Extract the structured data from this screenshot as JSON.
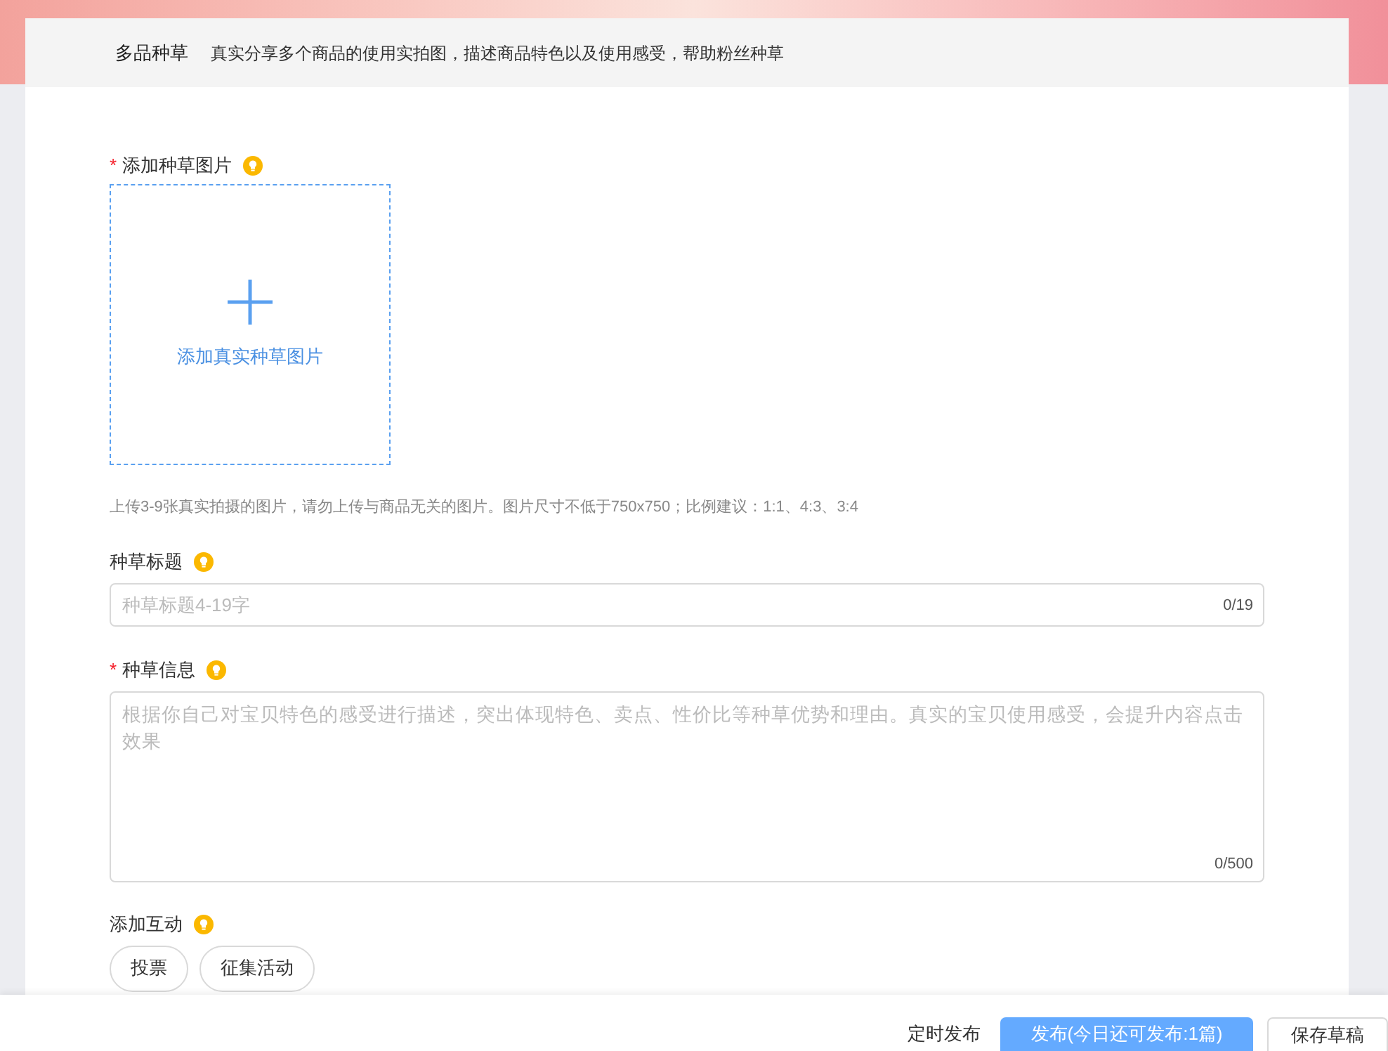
{
  "header": {
    "title": "多品种草",
    "description": "真实分享多个商品的使用实拍图，描述商品特色以及使用感受，帮助粉丝种草"
  },
  "image_upload": {
    "required_mark": "*",
    "label": "添加种草图片",
    "upload_text": "添加真实种草图片",
    "hint": "上传3-9张真实拍摄的图片，请勿上传与商品无关的图片。图片尺寸不低于750x750；比例建议：1:1、4:3、3:4"
  },
  "title_field": {
    "label": "种草标题",
    "placeholder": "种草标题4-19字",
    "counter": "0/19"
  },
  "info_field": {
    "required_mark": "*",
    "label": "种草信息",
    "placeholder": "根据你自己对宝贝特色的感受进行描述，突出体现特色、卖点、性价比等种草优势和理由。真实的宝贝使用感受，会提升内容点击效果",
    "counter": "0/500"
  },
  "interaction": {
    "label": "添加互动",
    "buttons": [
      "投票",
      "征集活动"
    ]
  },
  "footer": {
    "schedule": "定时发布",
    "publish": "发布(今日还可发布:1篇)",
    "draft": "保存草稿"
  }
}
